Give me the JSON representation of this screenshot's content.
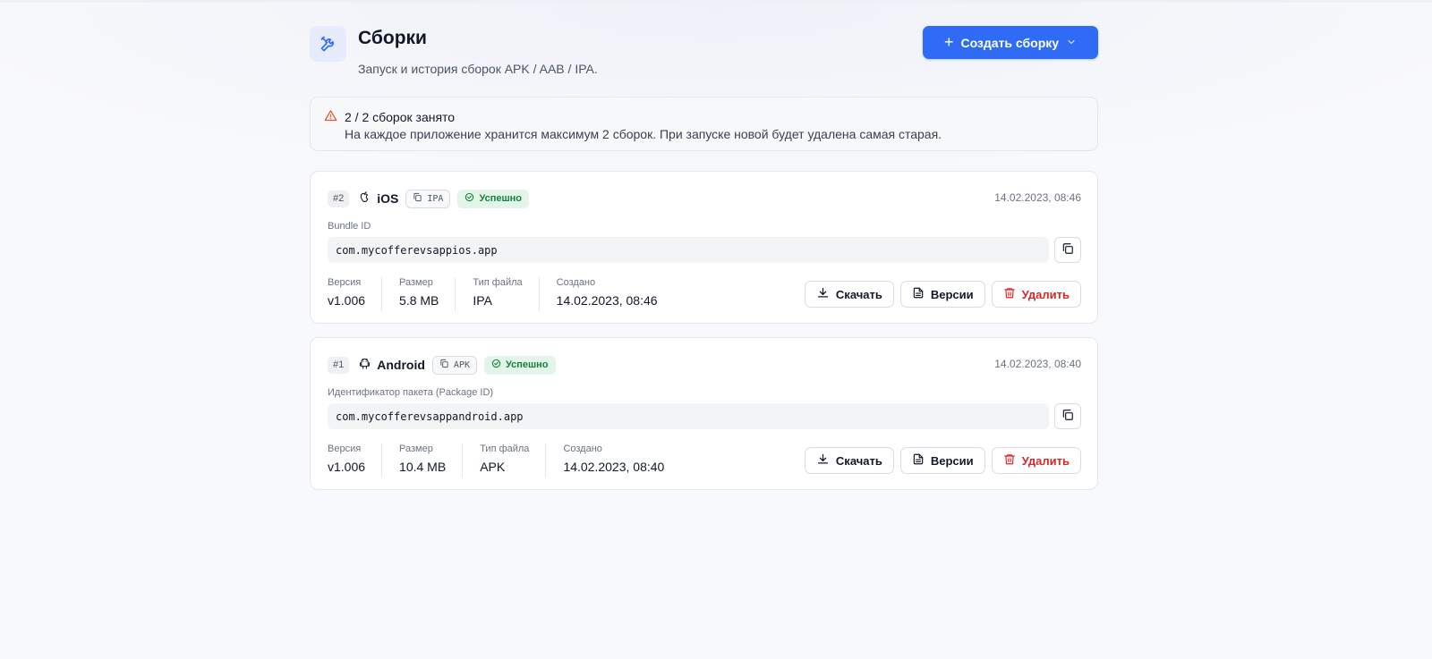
{
  "header": {
    "title": "Сборки",
    "subtitle": "Запуск и история сборок APK / AAB / IPA.",
    "create_label": "Создать сборку",
    "icon": "tools-icon"
  },
  "alert": {
    "title": "2 / 2 сборок занято",
    "text": "На каждое приложение хранится максимум 2 сборок. При запуске новой будет удалена самая старая."
  },
  "builds": [
    {
      "number": "#2",
      "platform": "iOS",
      "type": "IPA",
      "status": "Успешно",
      "date": "14.02.2023, 08:46",
      "id_label": "Bundle ID",
      "id_value": "com.mycofferevsappios.app",
      "meta": [
        {
          "label": "Версия",
          "value": "v1.006"
        },
        {
          "label": "Размер",
          "value": "5.8 MB"
        },
        {
          "label": "Тип файла",
          "value": "IPA"
        },
        {
          "label": "Создано",
          "value": "14.02.2023, 08:46"
        }
      ],
      "actions": {
        "download": "Скачать",
        "versions": "Версии",
        "delete": "Удалить"
      }
    },
    {
      "number": "#1",
      "platform": "Android",
      "type": "APK",
      "status": "Успешно",
      "date": "14.02.2023, 08:40",
      "id_label": "Идентификатор пакета (Package ID)",
      "id_value": "com.mycofferevsappandroid.app",
      "meta": [
        {
          "label": "Версия",
          "value": "v1.006"
        },
        {
          "label": "Размер",
          "value": "10.4 MB"
        },
        {
          "label": "Тип файла",
          "value": "APK"
        },
        {
          "label": "Создано",
          "value": "14.02.2023, 08:40"
        }
      ],
      "actions": {
        "download": "Скачать",
        "versions": "Версии",
        "delete": "Удалить"
      }
    }
  ],
  "colors": {
    "accent": "#2f6bf5",
    "success_bg": "#e3f5e8",
    "success_text": "#17803d",
    "danger": "#dc2626",
    "warning": "#dc5b2a"
  }
}
